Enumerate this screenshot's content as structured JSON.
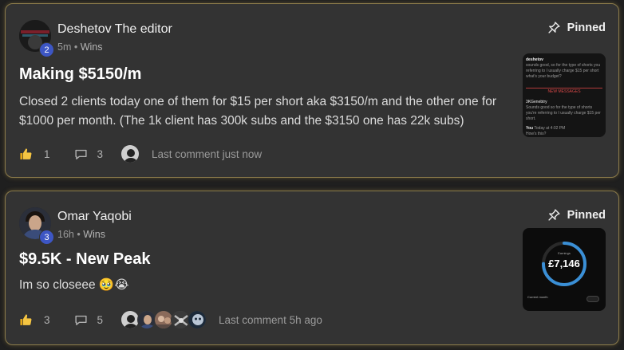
{
  "posts": [
    {
      "author": "Deshetov The editor",
      "level": "2",
      "time": "5m",
      "category": "Wins",
      "pinned_label": "Pinned",
      "title": "Making $5150/m",
      "body": "Closed 2 clients today one of them for $15 per short aka $3150/m and the other one for $1000 per month. (The 1k client has 300k subs and the $3150 one has 22k subs)",
      "likes": "1",
      "comments": "3",
      "last_comment": "Last comment just now",
      "thumb": {
        "header": "deshetov",
        "lines": [
          "sounds good, so for the type of shorts you",
          "referring to I usually charge $15 per short",
          "what's your budget?"
        ],
        "divider": "NEW MESSAGES",
        "reply_name": "3KGenebtry",
        "reply_lines": [
          "Sounds good so for the type of shorts",
          "you're referring to I usually charge $15 per short."
        ],
        "you_label": "You",
        "you_time": "Today at 4:02 PM",
        "you_text": "How's this?"
      }
    },
    {
      "author": "Omar Yaqobi",
      "level": "3",
      "time": "16h",
      "category": "Wins",
      "pinned_label": "Pinned",
      "title": "$9.5K - New Peak",
      "body": "Im so closeee 🥹😭",
      "likes": "3",
      "comments": "5",
      "last_comment": "Last comment 5h ago",
      "thumb": {
        "label": "Earnings",
        "amount": "£7,146",
        "ring_progress": 0.75,
        "footer_left": "Current month"
      }
    }
  ],
  "colors": {
    "accent_border": "#8a7a4a",
    "badge": "#3d56c4",
    "ring": "#3a8fd6"
  }
}
